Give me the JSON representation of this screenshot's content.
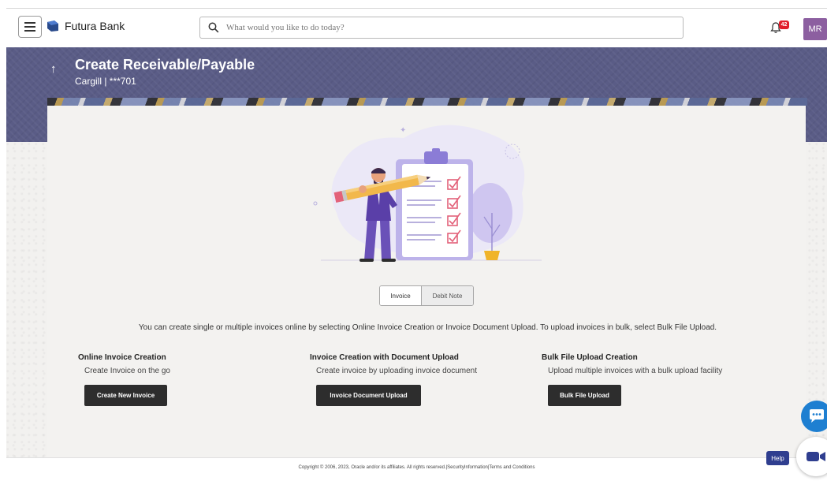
{
  "header": {
    "brand": "Futura Bank",
    "search_placeholder": "What would you like to do today?",
    "notification_count": "42",
    "user_initials": "MR"
  },
  "banner": {
    "title": "Create Receivable/Payable",
    "subtitle": "Cargill | ***701"
  },
  "toggle": {
    "options": [
      "Invoice",
      "Debit Note"
    ],
    "selected": "Invoice"
  },
  "intro_text": "You can create single or multiple invoices online by selecting Online Invoice Creation or Invoice Document Upload. To upload invoices in bulk, select Bulk File Upload.",
  "options": [
    {
      "title": "Online Invoice Creation",
      "description": "Create Invoice on the go",
      "button": "Create New Invoice"
    },
    {
      "title": "Invoice Creation with Document Upload",
      "description": "Create invoice by uploading invoice document",
      "button": "Invoice Document Upload"
    },
    {
      "title": "Bulk File Upload Creation",
      "description": "Upload multiple invoices with a bulk upload facility",
      "button": "Bulk File Upload"
    }
  ],
  "footer": {
    "text": "Copyright © 2006, 2023, Oracle and/or its affiliates. All rights reserved.|SecurityInformation|Terms and Conditions"
  },
  "help_label": "Help",
  "colors": {
    "banner": "#5a5c86",
    "avatar": "#8c5fa0",
    "button": "#2d2d2d",
    "badge": "#e11d2a",
    "help": "#2f3e8f",
    "chat": "#1e7fd1"
  }
}
